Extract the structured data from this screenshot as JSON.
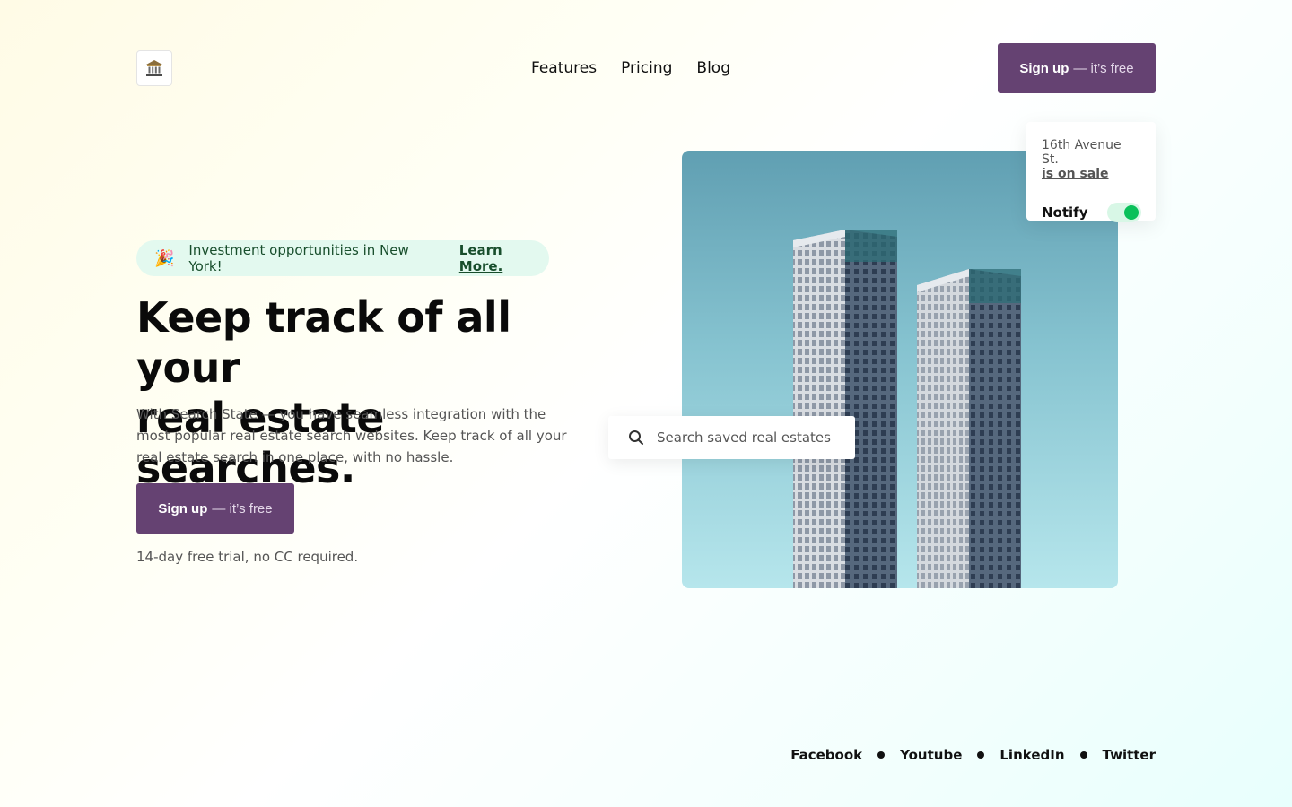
{
  "header": {
    "logo_icon": "bank-building-icon",
    "nav": [
      {
        "label": "Features"
      },
      {
        "label": "Pricing"
      },
      {
        "label": "Blog"
      }
    ],
    "cta": {
      "bold": "Sign up",
      "rest": "— it’s free"
    }
  },
  "banner": {
    "icon": "party-popper-icon",
    "text": "Investment opportunities in New York!",
    "link": "Learn More."
  },
  "hero": {
    "title_line1": "Keep track of all your",
    "title_line2": "real estate searches.",
    "description": "With Search State — you have seamless integration with the most popular real estate search websites. Keep track of all your real estate search in one place, with no hassle.",
    "cta": {
      "bold": "Sign up",
      "rest": "— it’s free"
    },
    "trial_note": "14-day free trial, no CC required."
  },
  "search": {
    "icon": "search-icon",
    "placeholder": "Search saved real estates"
  },
  "notify_card": {
    "address": "16th Avenue St.",
    "status": "is on sale",
    "toggle_label": "Notify",
    "toggle_on": true
  },
  "footer": {
    "links": [
      "Facebook",
      "Youtube",
      "LinkedIn",
      "Twitter"
    ]
  },
  "colors": {
    "brand": "#654272",
    "banner_bg": "#e3f9ef",
    "toggle_on": "#0ac05a"
  }
}
